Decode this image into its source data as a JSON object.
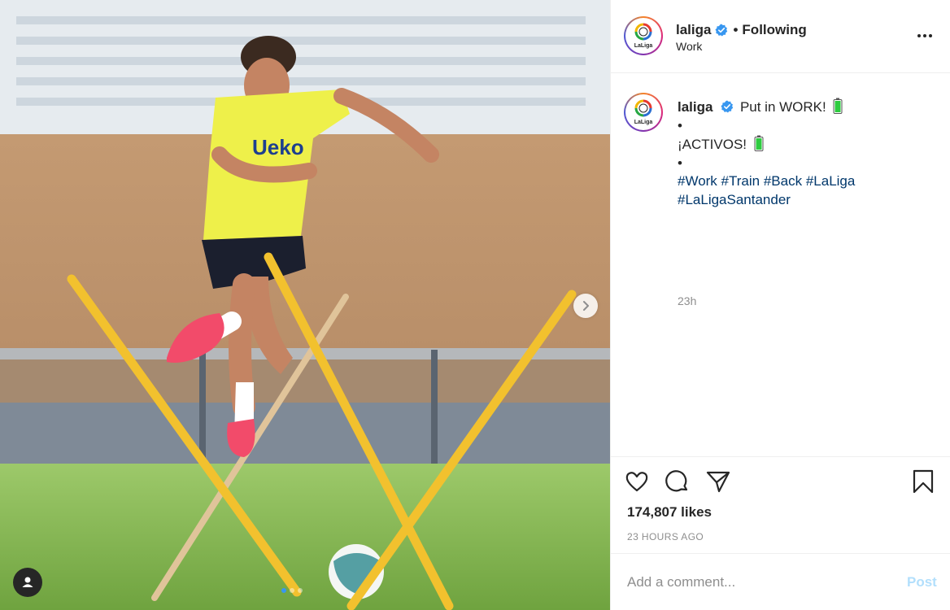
{
  "photo": {
    "alt": "",
    "carousel_dots": 3,
    "active_dot": 0
  },
  "header": {
    "username": "laliga",
    "separator": "•",
    "following_label": "Following",
    "location": "Work",
    "logo_text": "LaLiga"
  },
  "caption": {
    "username": "laliga",
    "line1": "Put in WORK!",
    "bullet1": "•",
    "line2": "¡ACTIVOS!",
    "bullet2": "•",
    "hashtags_line1": [
      "#Work",
      "#Train",
      "#Back",
      "#LaLiga"
    ],
    "hashtags_line2": [
      "#LaLigaSantander"
    ],
    "time": "23h"
  },
  "actions": {
    "likes": "174,807 likes",
    "posted_ago": "23 HOURS AGO"
  },
  "comment": {
    "placeholder": "Add a comment...",
    "post_label": "Post"
  },
  "colors": {
    "hashtag": "#00376b",
    "post_disabled": "#b2dffc",
    "verified": "#3897f0",
    "battery": "#2ecc40"
  }
}
